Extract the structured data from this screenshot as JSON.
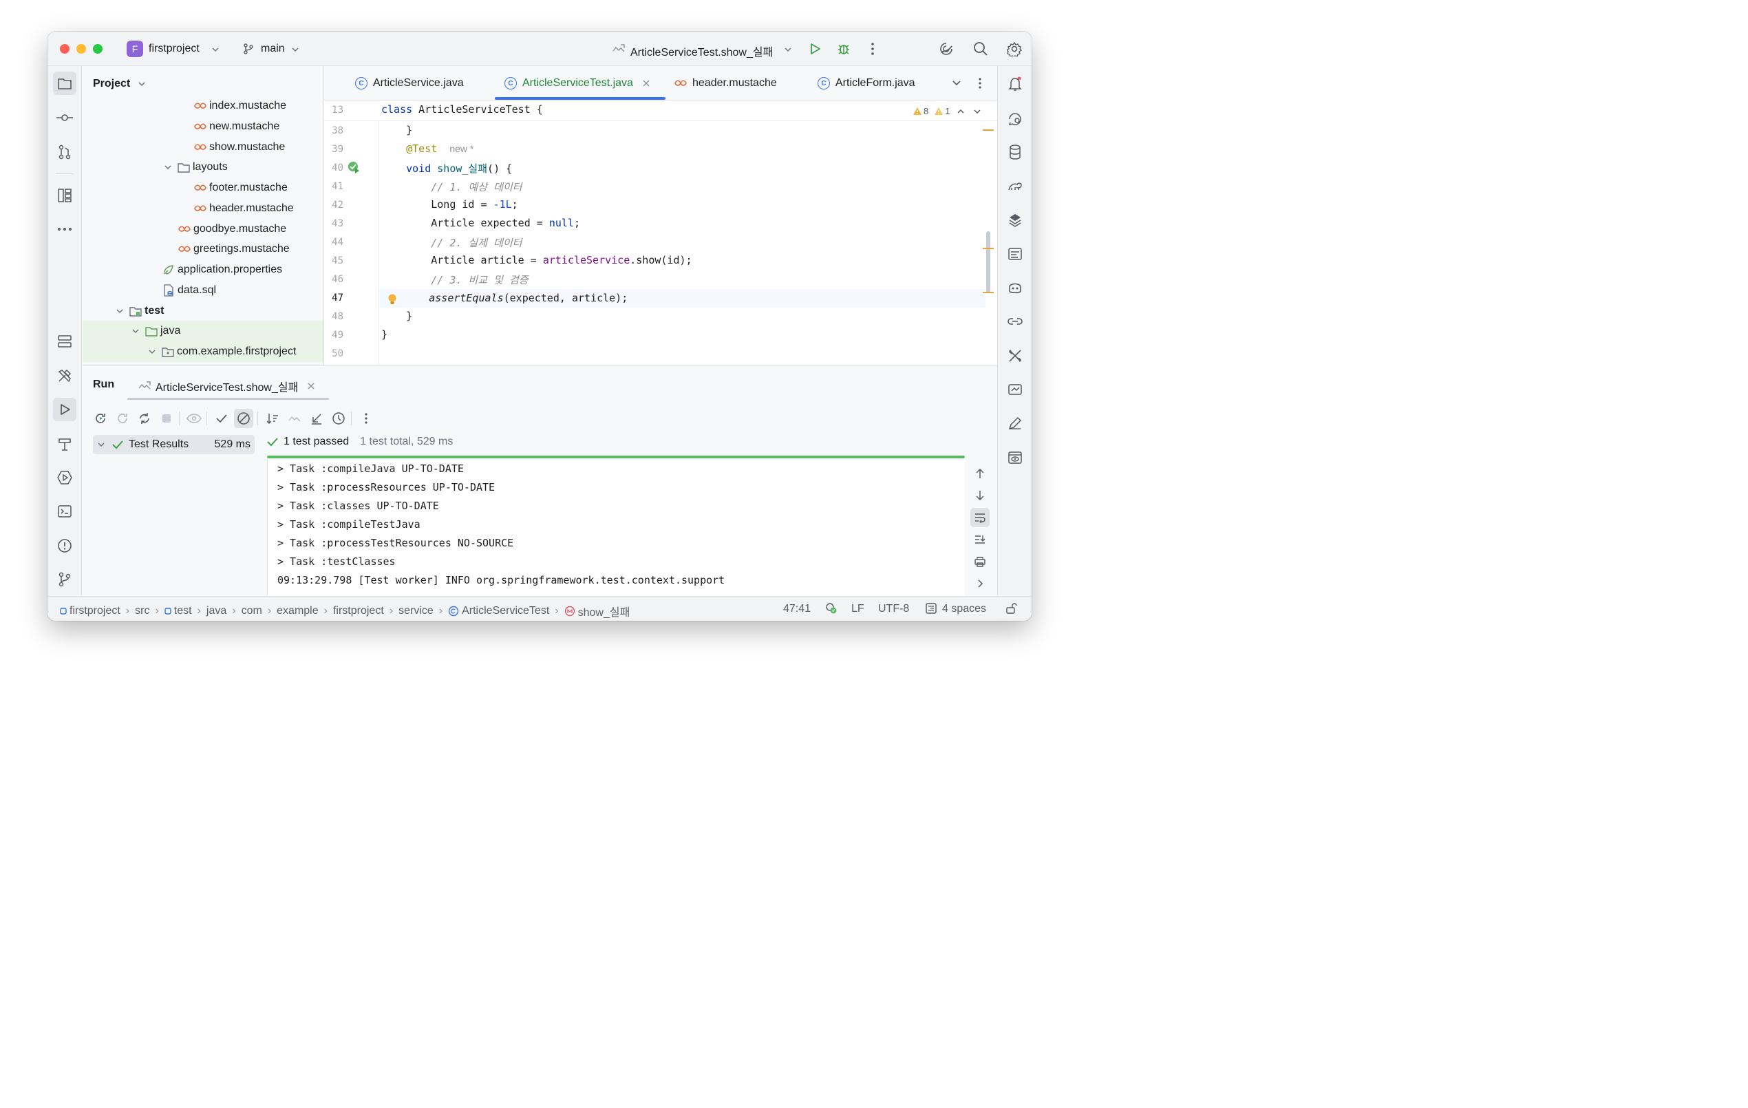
{
  "titlebar": {
    "project_initial": "F",
    "project_name": "firstproject",
    "branch": "main",
    "run_config": "ArticleServiceTest.show_실패"
  },
  "project_panel": {
    "title": "Project",
    "items": [
      {
        "label": "index.mustache",
        "kind": "mustache"
      },
      {
        "label": "new.mustache",
        "kind": "mustache"
      },
      {
        "label": "show.mustache",
        "kind": "mustache"
      },
      {
        "label": "layouts",
        "kind": "folder"
      },
      {
        "label": "footer.mustache",
        "kind": "mustache"
      },
      {
        "label": "header.mustache",
        "kind": "mustache"
      },
      {
        "label": "goodbye.mustache",
        "kind": "mustache"
      },
      {
        "label": "greetings.mustache",
        "kind": "mustache"
      },
      {
        "label": "application.properties",
        "kind": "properties"
      },
      {
        "label": "data.sql",
        "kind": "sql"
      },
      {
        "label": "test",
        "kind": "folder"
      },
      {
        "label": "java",
        "kind": "folder"
      },
      {
        "label": "com.example.firstproject",
        "kind": "package"
      }
    ]
  },
  "editor": {
    "tabs": [
      {
        "label": "ArticleService.java"
      },
      {
        "label": "ArticleServiceTest.java"
      },
      {
        "label": "header.mustache"
      },
      {
        "label": "ArticleForm.java"
      }
    ],
    "warnings": "8",
    "weak_warnings": "1",
    "sticky_line_number": "13",
    "line_numbers": [
      "38",
      "39",
      "40",
      "41",
      "42",
      "43",
      "44",
      "45",
      "46",
      "47",
      "48",
      "49",
      "50"
    ],
    "inlay_hint": "new *"
  },
  "run_panel": {
    "title": "Run",
    "tab_label": "ArticleServiceTest.show_실패",
    "results_label": "Test Results",
    "results_time": "529 ms",
    "passed_text": "1 test passed",
    "summary_text": "1 test total, 529 ms",
    "console_lines": [
      "> Task :compileJava UP-TO-DATE",
      "> Task :processResources UP-TO-DATE",
      "> Task :classes UP-TO-DATE",
      "> Task :compileTestJava",
      "> Task :processTestResources NO-SOURCE",
      "> Task :testClasses",
      "09:13:29.798 [Test worker] INFO org.springframework.test.context.support"
    ]
  },
  "statusbar": {
    "breadcrumbs": [
      "firstproject",
      "src",
      "test",
      "java",
      "com",
      "example",
      "firstproject",
      "service",
      "ArticleServiceTest",
      "show_실패"
    ],
    "position": "47:41",
    "line_sep": "LF",
    "encoding": "UTF-8",
    "indent": "4 spaces"
  },
  "colors": {
    "accent": "#3574f0",
    "success": "#5fb865",
    "active_tab_text": "#20863a",
    "keyword": "#0033b3",
    "annotation": "#9e880d",
    "comment": "#8c8c8c"
  }
}
